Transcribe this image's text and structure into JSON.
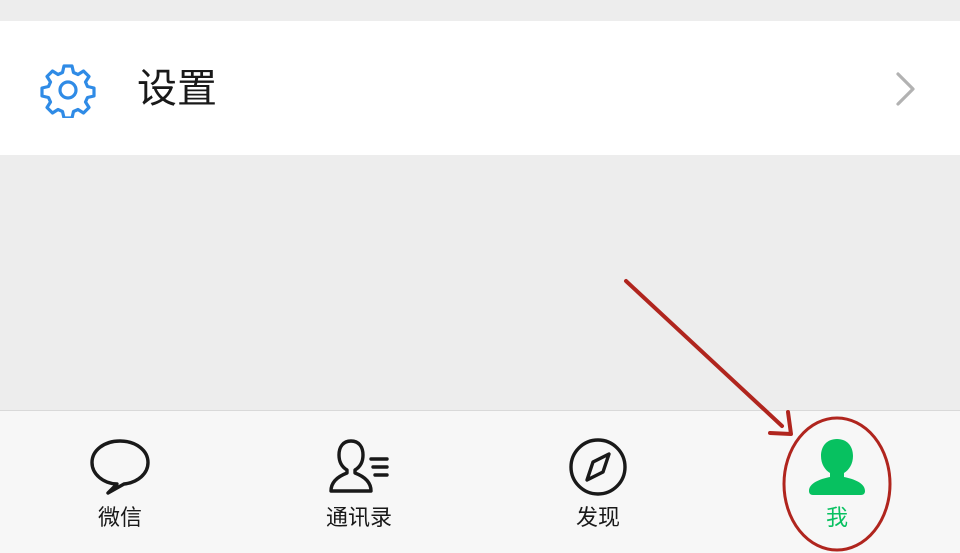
{
  "settings": {
    "label": "设置",
    "icon": "gear-icon"
  },
  "tabbar": {
    "tabs": [
      {
        "label": "微信",
        "icon": "chat-bubble-icon",
        "active": false
      },
      {
        "label": "通讯录",
        "icon": "contacts-icon",
        "active": false
      },
      {
        "label": "发现",
        "icon": "compass-icon",
        "active": false
      },
      {
        "label": "我",
        "icon": "person-icon",
        "active": true
      }
    ]
  },
  "colors": {
    "accent": "#07c160",
    "settings_icon": "#2f8be6",
    "annotation": "#b0251e",
    "background": "#ededed"
  }
}
